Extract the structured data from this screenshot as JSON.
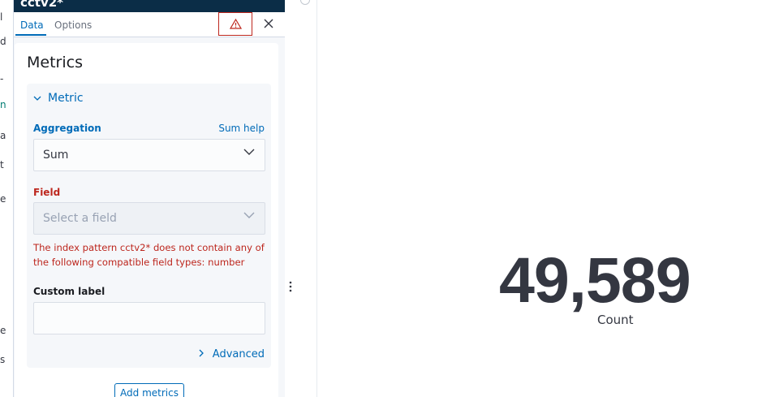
{
  "editor": {
    "index_pattern": "cctv2*",
    "tabs": [
      {
        "label": "Data",
        "active": true
      },
      {
        "label": "Options",
        "active": false
      }
    ],
    "warning_icon": "warning-triangle-icon",
    "close_icon": "close-icon"
  },
  "metrics": {
    "title": "Metrics",
    "section_label": "Metric",
    "aggregation": {
      "label": "Aggregation",
      "help_link": "Sum help",
      "value": "Sum"
    },
    "field": {
      "label": "Field",
      "placeholder": "Select a field",
      "error": "The index pattern cctv2* does not contain any of the following compatible field types: number"
    },
    "custom_label": {
      "label": "Custom label",
      "value": ""
    },
    "advanced_label": "Advanced",
    "add_button": "Add metrics"
  },
  "visualization": {
    "value": "49,589",
    "label": "Count"
  },
  "colors": {
    "primary": "#006bb8",
    "danger": "#bd271e",
    "header": "#0b2d47",
    "metric_text": "#343741"
  }
}
